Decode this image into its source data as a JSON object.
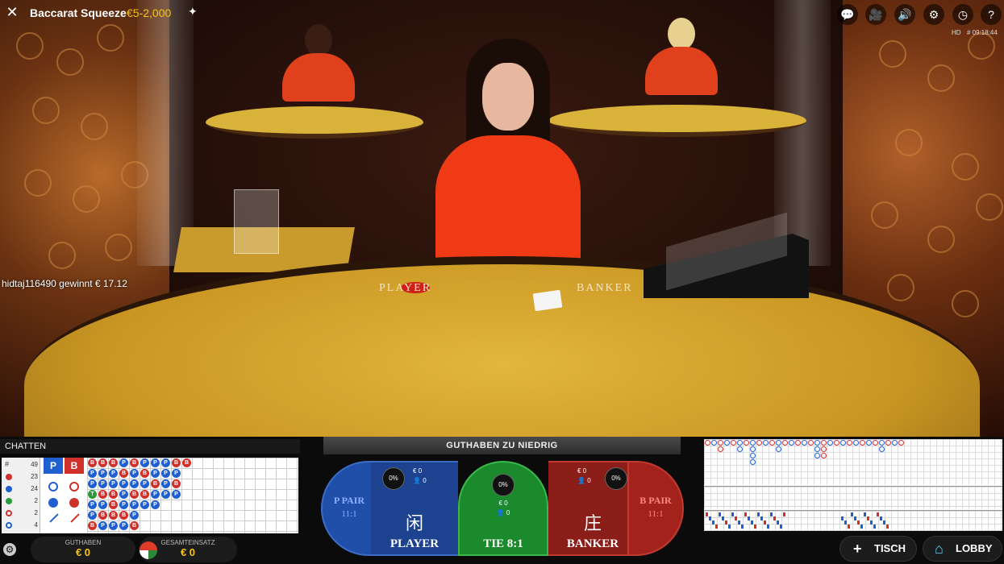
{
  "header": {
    "title": "Baccarat Squeeze",
    "limits": "€5-2,000",
    "hd": "HD",
    "session_time": "# 09:18:44"
  },
  "toolbar": {
    "icons": [
      "chat-icon",
      "video-icon",
      "volume-icon",
      "settings-icon",
      "history-icon",
      "help-icon"
    ]
  },
  "notification": "hidtaj116490 gewinnt € 17.12",
  "table_surface": {
    "player": "PLAYER",
    "banker": "BANKER"
  },
  "chat": {
    "label": "CHATTEN"
  },
  "statistics": [
    {
      "key": "total",
      "value": "49"
    },
    {
      "key": "banker",
      "value": "23"
    },
    {
      "key": "player",
      "value": "24"
    },
    {
      "key": "tie",
      "value": "2"
    },
    {
      "key": "banker_pair",
      "value": "2"
    },
    {
      "key": "player_pair",
      "value": "4"
    }
  ],
  "predictions": {
    "player": "P",
    "banker": "B"
  },
  "betting": {
    "status": "GUTHABEN ZU NIEDRIG",
    "player_pair": {
      "name": "P PAIR",
      "odds": "11:1"
    },
    "player": {
      "pct": "0%",
      "amount": "€ 0",
      "bettors": "0",
      "glyph": "闲",
      "label": "PLAYER"
    },
    "tie": {
      "pct": "0%",
      "amount": "€ 0",
      "bettors": "0",
      "label": "TIE 8:1"
    },
    "banker": {
      "pct": "0%",
      "amount": "€ 0",
      "bettors": "0",
      "glyph": "庄",
      "label": "BANKER"
    },
    "banker_pair": {
      "name": "B PAIR",
      "odds": "11:1"
    }
  },
  "balance": {
    "label": "GUTHABEN",
    "value": "€ 0"
  },
  "total_bet": {
    "label": "GESAMTEINSATZ",
    "value": "€ 0"
  },
  "buttons": {
    "table": "TISCH",
    "lobby": "LOBBY"
  },
  "bead_road": [
    [
      "B",
      "P",
      "P",
      "T",
      "P",
      "P",
      "B"
    ],
    [
      "B",
      "P",
      "P",
      "B",
      "P",
      "B",
      "P"
    ],
    [
      "B",
      "P",
      "P",
      "B",
      "B",
      "B",
      "P"
    ],
    [
      "P",
      "B",
      "P",
      "P",
      "P",
      "B",
      "P"
    ],
    [
      "B",
      "P",
      "P",
      "B",
      "P",
      "P",
      "B"
    ],
    [
      "P",
      "B",
      "P",
      "B",
      "P"
    ],
    [
      "P",
      "P",
      "B",
      "P",
      "P"
    ],
    [
      "P",
      "P",
      "P",
      "P"
    ],
    [
      "B",
      "P",
      "B",
      "P"
    ],
    [
      "B"
    ]
  ],
  "colors": {
    "player": "#1f5fd0",
    "banker": "#d0302a",
    "tie": "#2a9a3a",
    "gold": "#f5c518"
  }
}
